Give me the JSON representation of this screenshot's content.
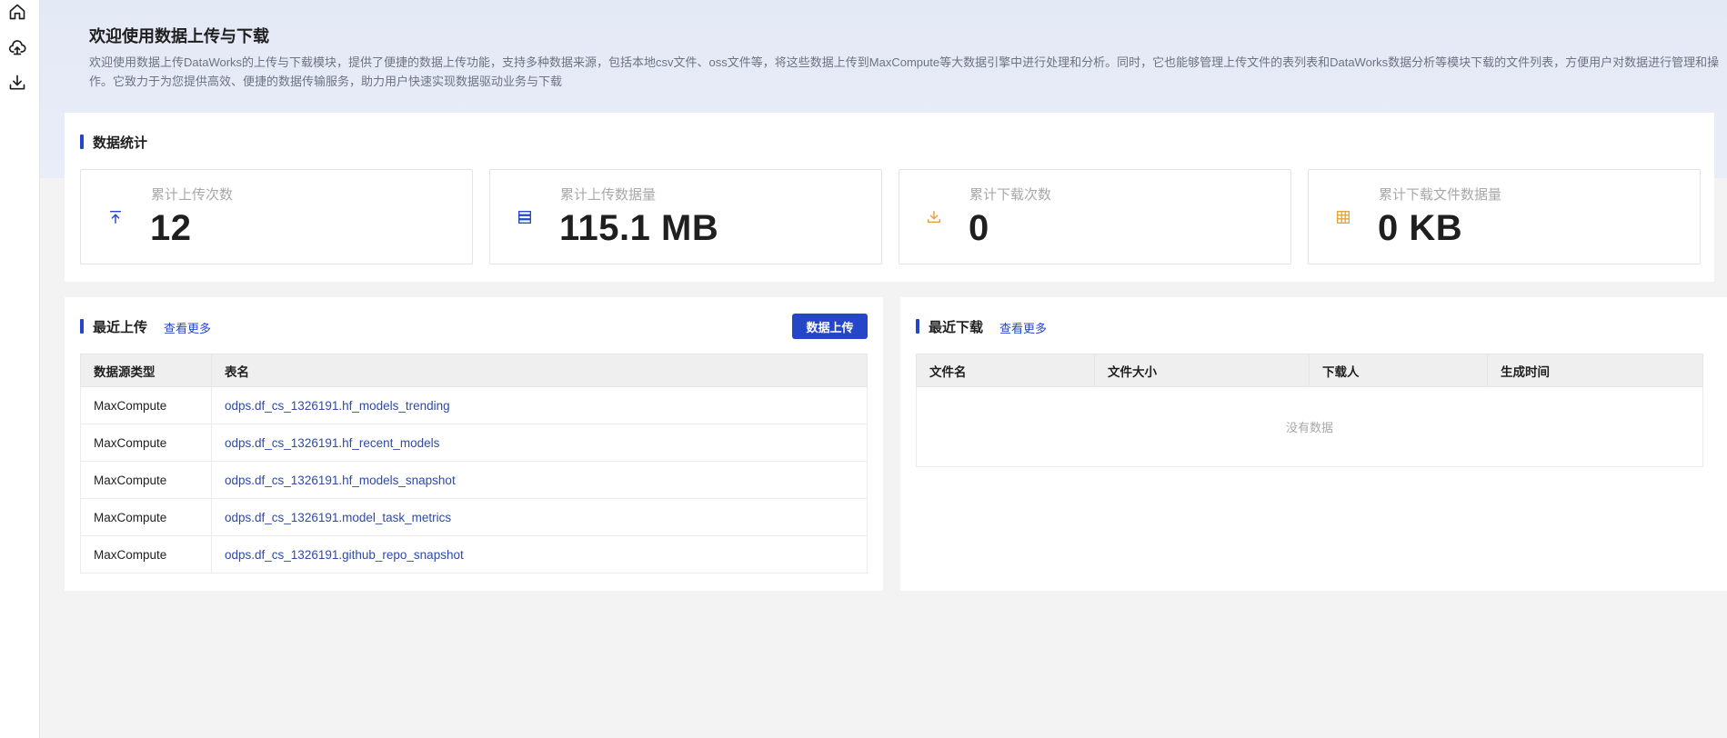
{
  "sidebar": {
    "items": [
      {
        "icon": "home-icon",
        "label": "home"
      },
      {
        "icon": "cloud-upload-icon",
        "label": "upload"
      },
      {
        "icon": "download-icon",
        "label": "download"
      }
    ]
  },
  "hero": {
    "title": "欢迎使用数据上传与下载",
    "description": "欢迎使用数据上传DataWorks的上传与下载模块，提供了便捷的数据上传功能，支持多种数据来源，包括本地csv文件、oss文件等，将这些数据上传到MaxCompute等大数据引擎中进行处理和分析。同时，它也能够管理上传文件的表列表和DataWorks数据分析等模块下载的文件列表，方便用户对数据进行管理和操作。它致力于为您提供高效、便捷的数据传输服务，助力用户快速实现数据驱动业务与下载"
  },
  "stats": {
    "title": "数据统计",
    "items": [
      {
        "label": "累计上传次数",
        "value": "12",
        "icon": "upload-arrow-icon",
        "color": "#2546c9"
      },
      {
        "label": "累计上传数据量",
        "value": "115.1 MB",
        "icon": "database-icon",
        "color": "#2546c9"
      },
      {
        "label": "累计下载次数",
        "value": "0",
        "icon": "download-arrow-icon",
        "color": "#e6a23c"
      },
      {
        "label": "累计下载文件数据量",
        "value": "0 KB",
        "icon": "table-icon",
        "color": "#e6a23c"
      }
    ]
  },
  "recent_upload": {
    "title": "最近上传",
    "more": "查看更多",
    "button": "数据上传",
    "columns": [
      "数据源类型",
      "表名"
    ],
    "rows": [
      [
        "MaxCompute",
        "odps.df_cs_1326191.hf_models_trending"
      ],
      [
        "MaxCompute",
        "odps.df_cs_1326191.hf_recent_models"
      ],
      [
        "MaxCompute",
        "odps.df_cs_1326191.hf_models_snapshot"
      ],
      [
        "MaxCompute",
        "odps.df_cs_1326191.model_task_metrics"
      ],
      [
        "MaxCompute",
        "odps.df_cs_1326191.github_repo_snapshot"
      ]
    ]
  },
  "recent_download": {
    "title": "最近下载",
    "more": "查看更多",
    "columns": [
      "文件名",
      "文件大小",
      "下载人",
      "生成时间"
    ],
    "empty": "没有数据"
  },
  "colors": {
    "accent": "#2546c9",
    "warning": "#e6a23c",
    "hero_bg": "#e4e9f6"
  }
}
